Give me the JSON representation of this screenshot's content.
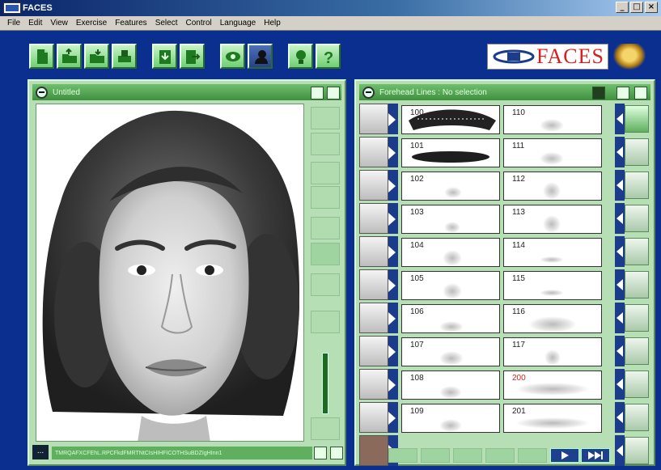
{
  "window": {
    "title": "FACES",
    "minimize": "_",
    "maximize": "□",
    "close": "×"
  },
  "menu": [
    "File",
    "Edit",
    "View",
    "Exercise",
    "Features",
    "Select",
    "Control",
    "Language",
    "Help"
  ],
  "logo": {
    "text": "FACES",
    "color": "#d62020"
  },
  "left_panel": {
    "title": "Untitled",
    "footer_code": "TMRQAFXCFEhL.RPCFkdFMRTNtCIsHIHFICOTHSuBDZIgHInn1",
    "dots_label": "..."
  },
  "right_panel": {
    "title": "Forehead Lines : No selection",
    "left_numbers": [
      "100",
      "101",
      "102",
      "103",
      "104",
      "105",
      "106",
      "107",
      "108",
      "109"
    ],
    "right_numbers": [
      "110",
      "111",
      "112",
      "113",
      "114",
      "115",
      "116",
      "117",
      "200",
      "201"
    ],
    "highlight_number": "200"
  },
  "colors": {
    "desktop_blue": "#0b2f8f",
    "panel_green": "#b6dfb6",
    "header_green": "#4f9f4f",
    "accent_red": "#d62020"
  }
}
